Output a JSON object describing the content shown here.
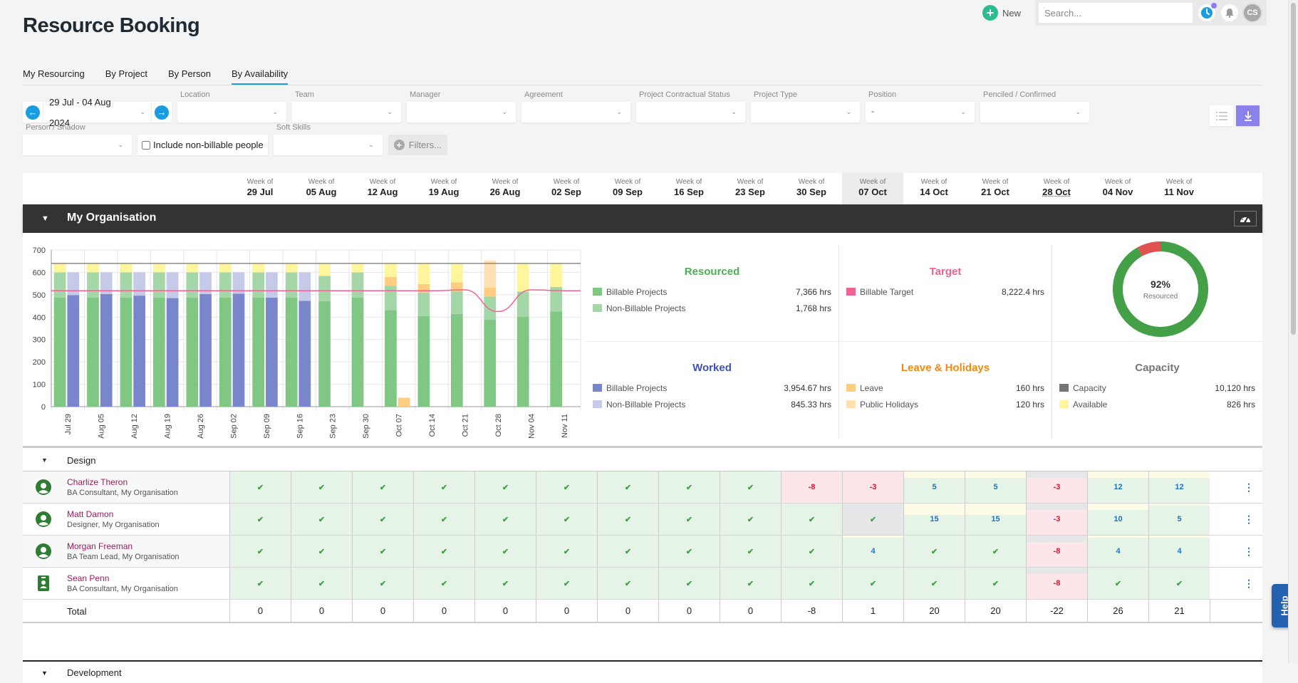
{
  "header": {
    "title": "Resource Booking",
    "new_label": "New",
    "search_placeholder": "Search...",
    "avatar_initials": "CS"
  },
  "tabs": [
    {
      "label": "My Resourcing",
      "active": false
    },
    {
      "label": "By Project",
      "active": false
    },
    {
      "label": "By Person",
      "active": false
    },
    {
      "label": "By Availability",
      "active": true
    }
  ],
  "filters": {
    "date_range": "29 Jul - 04 Aug 2024",
    "row1": [
      {
        "label": "Location",
        "value": ""
      },
      {
        "label": "Team",
        "value": ""
      },
      {
        "label": "Manager",
        "value": ""
      },
      {
        "label": "Agreement",
        "value": ""
      },
      {
        "label": "Project Contractual Status",
        "value": ""
      },
      {
        "label": "Project Type",
        "value": ""
      },
      {
        "label": "Position",
        "value": "-"
      },
      {
        "label": "Penciled / Confirmed",
        "value": ""
      }
    ],
    "person_shadow": {
      "label": "Person / Shadow",
      "value": ""
    },
    "include_nonbillable": {
      "label": "Include non-billable people",
      "checked": false
    },
    "soft_skills": {
      "label": "Soft Skills",
      "value": ""
    },
    "filters_button": "Filters..."
  },
  "weeks": [
    {
      "label": "Week of",
      "date": "29 Jul"
    },
    {
      "label": "Week of",
      "date": "05 Aug"
    },
    {
      "label": "Week of",
      "date": "12 Aug"
    },
    {
      "label": "Week of",
      "date": "19 Aug"
    },
    {
      "label": "Week of",
      "date": "26 Aug"
    },
    {
      "label": "Week of",
      "date": "02 Sep"
    },
    {
      "label": "Week of",
      "date": "09 Sep"
    },
    {
      "label": "Week of",
      "date": "16 Sep"
    },
    {
      "label": "Week of",
      "date": "23 Sep"
    },
    {
      "label": "Week of",
      "date": "30 Sep"
    },
    {
      "label": "Week of",
      "date": "07 Oct",
      "highlight": true
    },
    {
      "label": "Week of",
      "date": "14 Oct"
    },
    {
      "label": "Week of",
      "date": "21 Oct"
    },
    {
      "label": "Week of",
      "date": "28 Oct",
      "dotted": true
    },
    {
      "label": "Week of",
      "date": "04 Nov"
    },
    {
      "label": "Week of",
      "date": "11 Nov"
    }
  ],
  "organisation": {
    "name": "My Organisation"
  },
  "colors": {
    "resourced_billable": "#81c784",
    "resourced_nonbillable": "#a5d6a7",
    "worked_billable": "#7986cb",
    "worked_nonbillable": "#c5cae9",
    "leave": "#ffcc80",
    "public_holidays": "#ffe0b2",
    "available": "#fff59d",
    "capacity": "#757575",
    "target": "#f06292",
    "donut_good": "#43a047",
    "donut_bad": "#e05252"
  },
  "stats": {
    "resourced": {
      "title": "Resourced",
      "color": "#4caf50",
      "rows": [
        {
          "label": "Billable Projects",
          "value": "7,366 hrs",
          "swatch": "#81c784"
        },
        {
          "label": "Non-Billable Projects",
          "value": "1,768 hrs",
          "swatch": "#a5d6a7"
        }
      ]
    },
    "target": {
      "title": "Target",
      "color": "#ec5f8f",
      "rows": [
        {
          "label": "Billable Target",
          "value": "8,222.4 hrs",
          "swatch": "#f06292"
        }
      ]
    },
    "worked": {
      "title": "Worked",
      "color": "#3f51b5",
      "rows": [
        {
          "label": "Billable Projects",
          "value": "3,954.67 hrs",
          "swatch": "#7986cb"
        },
        {
          "label": "Non-Billable Projects",
          "value": "845.33 hrs",
          "swatch": "#c5cae9"
        }
      ]
    },
    "leave": {
      "title": "Leave & Holidays",
      "color": "#f5890c",
      "rows": [
        {
          "label": "Leave",
          "value": "160 hrs",
          "swatch": "#ffcc80"
        },
        {
          "label": "Public Holidays",
          "value": "120 hrs",
          "swatch": "#ffe0b2"
        }
      ]
    },
    "capacity": {
      "title": "Capacity",
      "color": "#757575",
      "rows": [
        {
          "label": "Capacity",
          "value": "10,120 hrs",
          "swatch": "#757575"
        },
        {
          "label": "Available",
          "value": "826 hrs",
          "swatch": "#fff59d"
        }
      ]
    },
    "donut": {
      "percent": 92,
      "value_label": "92%",
      "caption": "Resourced"
    }
  },
  "chart_data": {
    "type": "bar",
    "title": "",
    "xlabel": "",
    "ylabel": "",
    "ylim": [
      0,
      700
    ],
    "yticks": [
      0,
      100,
      200,
      300,
      400,
      500,
      600,
      700
    ],
    "grid": true,
    "categories": [
      "Jul 29",
      "Aug 05",
      "Aug 12",
      "Aug 19",
      "Aug 26",
      "Sep 02",
      "Sep 09",
      "Sep 16",
      "Sep 23",
      "Sep 30",
      "Oct 07",
      "Oct 14",
      "Oct 21",
      "Oct 28",
      "Nov 04",
      "Nov 11"
    ],
    "capacity_line": 640,
    "stacked_resourced": [
      {
        "name": "Billable Projects",
        "values": [
          488,
          488,
          488,
          488,
          488,
          488,
          488,
          488,
          472,
          488,
          432,
          404,
          414,
          388,
          402,
          425
        ]
      },
      {
        "name": "Non-Billable Projects",
        "values": [
          112,
          112,
          112,
          112,
          112,
          112,
          112,
          112,
          112,
          112,
          108,
          106,
          102,
          104,
          112,
          110
        ]
      },
      {
        "name": "Leave",
        "values": [
          0,
          0,
          0,
          0,
          0,
          0,
          0,
          0,
          0,
          0,
          40,
          38,
          40,
          40,
          0,
          0
        ]
      },
      {
        "name": "Public Holidays",
        "values": [
          0,
          0,
          0,
          0,
          0,
          0,
          0,
          0,
          0,
          0,
          0,
          0,
          0,
          120,
          0,
          0
        ]
      },
      {
        "name": "Available",
        "values": [
          40,
          40,
          40,
          40,
          40,
          40,
          40,
          40,
          56,
          40,
          60,
          92,
          84,
          0,
          126,
          105
        ]
      }
    ],
    "stacked_worked": [
      {
        "name": "Worked Billable",
        "values": [
          498,
          503,
          496,
          485,
          503,
          505,
          487,
          473,
          0,
          0,
          0,
          0,
          0,
          0,
          0,
          0
        ]
      },
      {
        "name": "Worked Non-Billable",
        "values": [
          102,
          97,
          104,
          115,
          97,
          95,
          113,
          127,
          0,
          0,
          0,
          0,
          0,
          0,
          0,
          0
        ]
      },
      {
        "name": "Worked Leave",
        "values": [
          0,
          0,
          0,
          0,
          0,
          0,
          0,
          0,
          0,
          0,
          40,
          0,
          0,
          0,
          0,
          0
        ]
      }
    ],
    "target_line": {
      "name": "Billable Target",
      "values": [
        518,
        518,
        518,
        518,
        518,
        518,
        518,
        518,
        518,
        518,
        518,
        518,
        522,
        425,
        522,
        518
      ]
    }
  },
  "groups": [
    {
      "name": "Design",
      "people": [
        {
          "name": "Charlize Theron",
          "role": "BA Consultant, My Organisation",
          "avatar": "person",
          "cells": [
            {
              "t": "check",
              "c": "g"
            },
            {
              "t": "check",
              "c": "g"
            },
            {
              "t": "check",
              "c": "g"
            },
            {
              "t": "check",
              "c": "g"
            },
            {
              "t": "check",
              "c": "g"
            },
            {
              "t": "check",
              "c": "g"
            },
            {
              "t": "check",
              "c": "g"
            },
            {
              "t": "check",
              "c": "g"
            },
            {
              "t": "check",
              "c": "g"
            },
            {
              "t": "-8",
              "c": "r"
            },
            {
              "t": "-3",
              "c": "r"
            },
            {
              "t": "5",
              "c": "g",
              "strip": "y"
            },
            {
              "t": "5",
              "c": "g",
              "strip": "y"
            },
            {
              "t": "-3",
              "c": "r",
              "strip": "gray"
            },
            {
              "t": "12",
              "c": "g",
              "strip": "y"
            },
            {
              "t": "12",
              "c": "g",
              "strip": "y"
            }
          ]
        },
        {
          "name": "Matt Damon",
          "role": "Designer, My Organisation",
          "avatar": "person",
          "cells": [
            {
              "t": "check",
              "c": "g"
            },
            {
              "t": "check",
              "c": "g"
            },
            {
              "t": "check",
              "c": "g"
            },
            {
              "t": "check",
              "c": "g"
            },
            {
              "t": "check",
              "c": "g"
            },
            {
              "t": "check",
              "c": "g"
            },
            {
              "t": "check",
              "c": "g"
            },
            {
              "t": "check",
              "c": "g"
            },
            {
              "t": "check",
              "c": "g"
            },
            {
              "t": "check",
              "c": "g"
            },
            {
              "t": "check",
              "c": "gray"
            },
            {
              "t": "15",
              "c": "g",
              "strip": "y2"
            },
            {
              "t": "15",
              "c": "g",
              "strip": "y2"
            },
            {
              "t": "-3",
              "c": "r",
              "strip": "gray"
            },
            {
              "t": "10",
              "c": "g",
              "strip": "y"
            },
            {
              "t": "5",
              "c": "g",
              "strip": "ys"
            }
          ]
        },
        {
          "name": "Morgan Freeman",
          "role": "BA Team Lead, My Organisation",
          "avatar": "person",
          "cells": [
            {
              "t": "check",
              "c": "g"
            },
            {
              "t": "check",
              "c": "g"
            },
            {
              "t": "check",
              "c": "g"
            },
            {
              "t": "check",
              "c": "g"
            },
            {
              "t": "check",
              "c": "g"
            },
            {
              "t": "check",
              "c": "g"
            },
            {
              "t": "check",
              "c": "g"
            },
            {
              "t": "check",
              "c": "g"
            },
            {
              "t": "check",
              "c": "g"
            },
            {
              "t": "check",
              "c": "g"
            },
            {
              "t": "4",
              "c": "g",
              "strip": "ys"
            },
            {
              "t": "check",
              "c": "g"
            },
            {
              "t": "check",
              "c": "g"
            },
            {
              "t": "-8",
              "c": "r",
              "strip": "gray"
            },
            {
              "t": "4",
              "c": "g",
              "strip": "ys"
            },
            {
              "t": "4",
              "c": "g",
              "strip": "ys"
            }
          ]
        },
        {
          "name": "Sean Penn",
          "role": "BA Consultant, My Organisation",
          "avatar": "badge",
          "cells": [
            {
              "t": "check",
              "c": "g"
            },
            {
              "t": "check",
              "c": "g"
            },
            {
              "t": "check",
              "c": "g"
            },
            {
              "t": "check",
              "c": "g"
            },
            {
              "t": "check",
              "c": "g"
            },
            {
              "t": "check",
              "c": "g"
            },
            {
              "t": "check",
              "c": "g"
            },
            {
              "t": "check",
              "c": "g"
            },
            {
              "t": "check",
              "c": "g"
            },
            {
              "t": "check",
              "c": "g"
            },
            {
              "t": "check",
              "c": "g"
            },
            {
              "t": "check",
              "c": "g"
            },
            {
              "t": "check",
              "c": "g"
            },
            {
              "t": "-8",
              "c": "r",
              "strip": "gray"
            },
            {
              "t": "check",
              "c": "g"
            },
            {
              "t": "check",
              "c": "g"
            }
          ]
        }
      ],
      "total_label": "Total",
      "totals": [
        "0",
        "0",
        "0",
        "0",
        "0",
        "0",
        "0",
        "0",
        "0",
        "-8",
        "1",
        "20",
        "20",
        "-22",
        "26",
        "21"
      ]
    },
    {
      "name": "Development"
    }
  ],
  "help_label": "Help"
}
